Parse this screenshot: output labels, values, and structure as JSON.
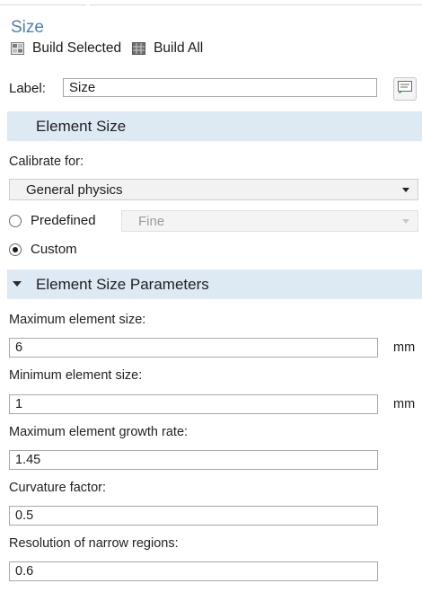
{
  "window": {
    "title": "Size"
  },
  "toolbar": {
    "build_selected": "Build Selected",
    "build_all": "Build All"
  },
  "label_field": {
    "label": "Label:",
    "value": "Size"
  },
  "element_size": {
    "heading": "Element Size",
    "calibrate_label": "Calibrate for:",
    "calibrate_value": "General physics",
    "predefined_label": "Predefined",
    "predefined_value": "Fine",
    "custom_label": "Custom",
    "selected": "Custom"
  },
  "parameters": {
    "heading": "Element Size Parameters",
    "fields": [
      {
        "label": "Maximum element size:",
        "value": "6",
        "unit": "mm"
      },
      {
        "label": "Minimum element size:",
        "value": "1",
        "unit": "mm"
      },
      {
        "label": "Maximum element growth rate:",
        "value": "1.45"
      },
      {
        "label": "Curvature factor:",
        "value": "0.5"
      },
      {
        "label": "Resolution of narrow regions:",
        "value": "0.6"
      }
    ]
  },
  "icons": {
    "build_selected": "build-selected-icon",
    "build_all": "build-all-icon",
    "label_action": "label-edit-icon",
    "section_collapse": "chevron-down-icon"
  },
  "colors": {
    "title": "#4f7fb0",
    "section_bg": "#dde9f3"
  }
}
